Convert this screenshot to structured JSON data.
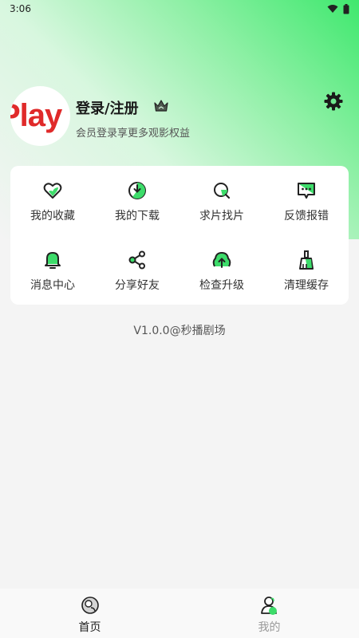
{
  "status": {
    "time": "3:06"
  },
  "profile": {
    "avatar_text": "Play",
    "title": "登录/注册",
    "subtitle": "会员登录享更多观影权益"
  },
  "menu": {
    "items": [
      {
        "label": "我的收藏",
        "icon": "heart-icon"
      },
      {
        "label": "我的下载",
        "icon": "download-icon"
      },
      {
        "label": "求片找片",
        "icon": "search-film-icon"
      },
      {
        "label": "反馈报错",
        "icon": "feedback-icon"
      },
      {
        "label": "消息中心",
        "icon": "bell-icon"
      },
      {
        "label": "分享好友",
        "icon": "share-icon"
      },
      {
        "label": "检查升级",
        "icon": "upgrade-icon"
      },
      {
        "label": "清理缓存",
        "icon": "broom-icon"
      }
    ]
  },
  "footer": {
    "version": "V1.0.0@秒播剧场"
  },
  "tabbar": {
    "home": "首页",
    "mine": "我的"
  },
  "colors": {
    "accent": "#3ddc6a",
    "text": "#222222"
  }
}
